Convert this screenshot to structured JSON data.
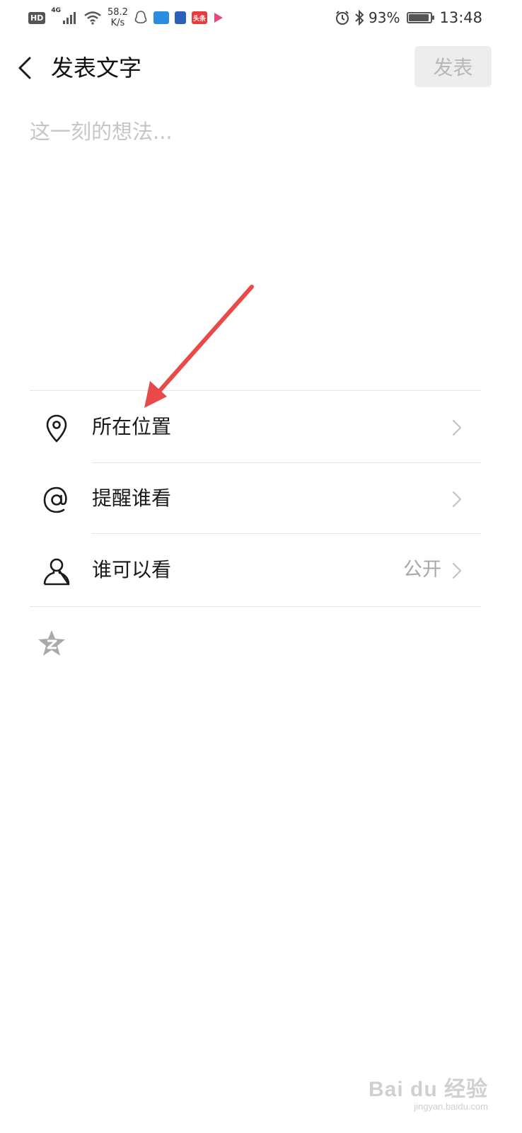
{
  "status_bar": {
    "hd": "HD",
    "signal_type": "4G",
    "net_speed_value": "58.2",
    "net_speed_unit": "K/s",
    "app_icon_toutiao": "头条",
    "battery_percent_text": "93%",
    "battery_level": 0.93,
    "time": "13:48"
  },
  "header": {
    "title": "发表文字",
    "publish_label": "发表"
  },
  "composer": {
    "placeholder": "这一刻的想法..."
  },
  "options": [
    {
      "label": "所在位置",
      "icon": "location-pin-icon",
      "value": ""
    },
    {
      "label": "提醒谁看",
      "icon": "at-sign-icon",
      "value": ""
    },
    {
      "label": "谁可以看",
      "icon": "person-icon",
      "value": "公开"
    }
  ],
  "extras": {
    "qzone_icon": "qzone-star-icon"
  },
  "annotation": {
    "color": "#e84a4a"
  },
  "watermark": {
    "brand": "Bai du 经验",
    "url": "jingyan.baidu.com"
  }
}
